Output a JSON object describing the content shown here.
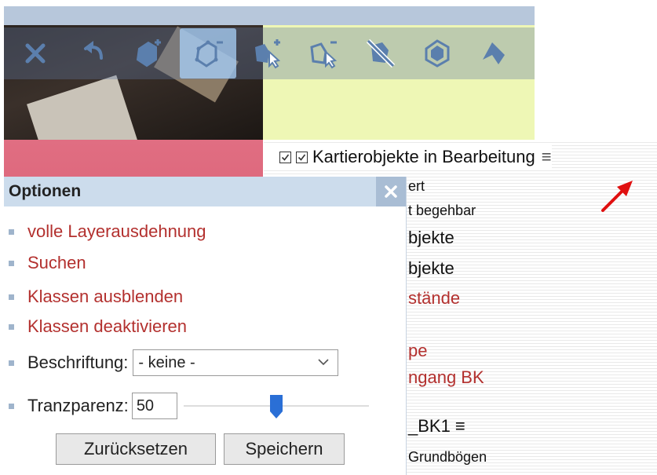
{
  "toolbar": {
    "tools": [
      {
        "icon": "close-icon",
        "active": false
      },
      {
        "icon": "undo-icon",
        "active": false
      },
      {
        "icon": "polygon-add-icon",
        "active": false
      },
      {
        "icon": "polygon-subtract-icon",
        "active": true
      },
      {
        "icon": "select-add-icon",
        "active": false
      },
      {
        "icon": "select-subtract-icon",
        "active": false
      },
      {
        "icon": "delete-feature-icon",
        "active": false
      },
      {
        "icon": "buffer-icon",
        "active": false
      },
      {
        "icon": "transform-icon",
        "active": false
      }
    ]
  },
  "layer_tree": {
    "title": "Kartierobjekte in Bearbeitung",
    "rows": [
      {
        "text": "ert",
        "style": "small"
      },
      {
        "text": "t begehbar",
        "style": "small"
      },
      {
        "text": "bjekte",
        "style": "big"
      },
      {
        "text": "bjekte",
        "style": "big"
      },
      {
        "text": "stände",
        "style": "red"
      },
      {
        "text": "pe",
        "style": "red"
      },
      {
        "text": "ngang BK",
        "style": "red"
      },
      {
        "text": "_BK1 ≡",
        "style": "big"
      },
      {
        "text": "Grundbögen",
        "style": "small"
      }
    ]
  },
  "options_panel": {
    "title": "Optionen",
    "links": [
      "volle Layerausdehnung",
      "Suchen",
      "Klassen ausblenden",
      "Klassen deaktivieren"
    ],
    "beschriftung_label": "Beschriftung:",
    "beschriftung_value": "- keine -",
    "transparency_label": "Tranzparenz:",
    "transparency_value": "50",
    "transparency_slider_fraction": 0.5,
    "reset_label": "Zurücksetzen",
    "save_label": "Speichern"
  },
  "colors": {
    "link": "#b3302e",
    "panel_header": "#ccdcec",
    "toolbar_icon": "#5b7fad",
    "slider_thumb": "#2a6fd6"
  }
}
